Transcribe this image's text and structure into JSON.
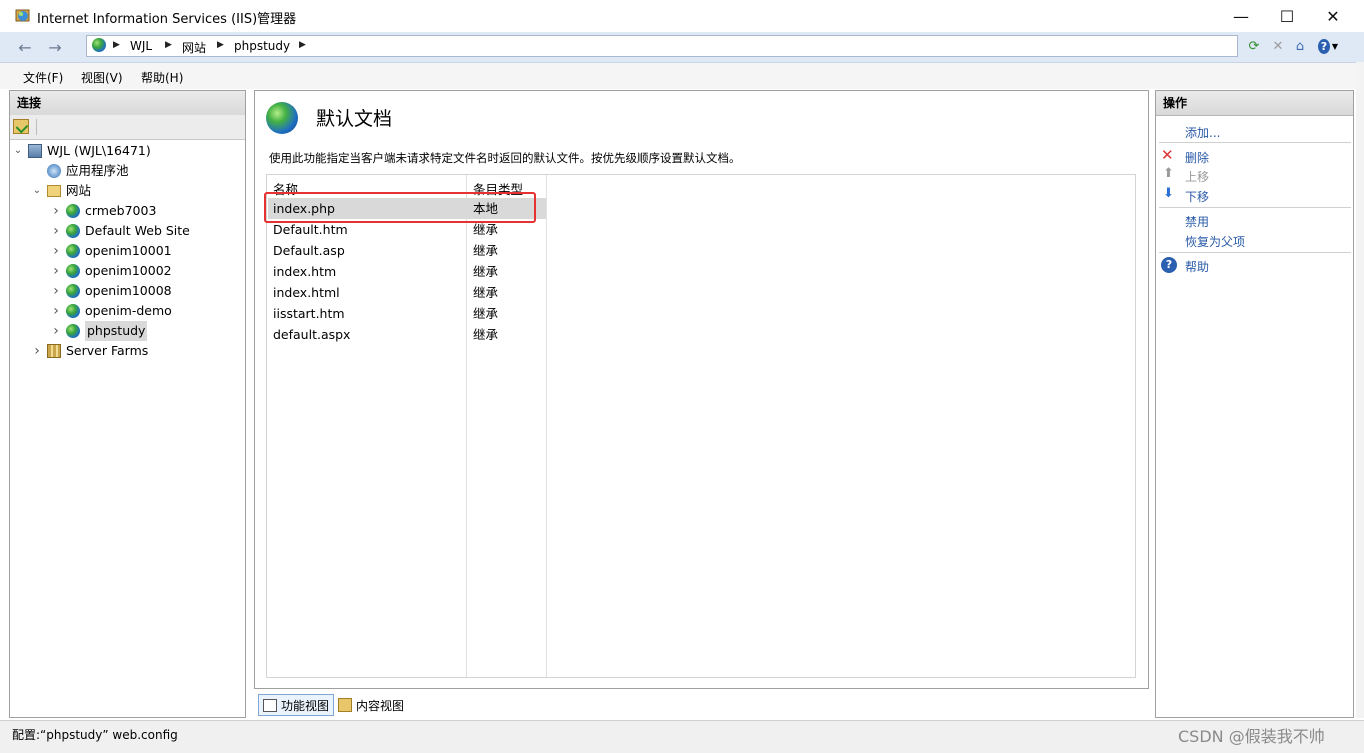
{
  "window": {
    "title": "Internet Information Services (IIS)管理器"
  },
  "breadcrumb": [
    "WJL",
    "网站",
    "phpstudy"
  ],
  "menu": [
    "文件(F)",
    "视图(V)",
    "帮助(H)"
  ],
  "connections": {
    "title": "连接",
    "tree": [
      {
        "label": "WJL (WJL\\16471)",
        "level": 0,
        "expanded": true,
        "icon": "server-icon"
      },
      {
        "label": "应用程序池",
        "level": 1,
        "expanded": null,
        "icon": "app-pool-icon"
      },
      {
        "label": "网站",
        "level": 1,
        "expanded": true,
        "icon": "folder-icon"
      },
      {
        "label": "crmeb7003",
        "level": 2,
        "expanded": false,
        "icon": "globe-icon"
      },
      {
        "label": "Default Web Site",
        "level": 2,
        "expanded": false,
        "icon": "globe-icon"
      },
      {
        "label": "openim10001",
        "level": 2,
        "expanded": false,
        "icon": "globe-icon"
      },
      {
        "label": "openim10002",
        "level": 2,
        "expanded": false,
        "icon": "globe-icon"
      },
      {
        "label": "openim10008",
        "level": 2,
        "expanded": false,
        "icon": "globe-icon"
      },
      {
        "label": "openim-demo",
        "level": 2,
        "expanded": false,
        "icon": "globe-icon"
      },
      {
        "label": "phpstudy",
        "level": 2,
        "expanded": false,
        "icon": "globe-icon",
        "selected": true
      },
      {
        "label": "Server Farms",
        "level": 1,
        "expanded": false,
        "icon": "server-farms-icon"
      }
    ]
  },
  "main": {
    "title": "默认文档",
    "description": "使用此功能指定当客户端未请求特定文件名时返回的默认文件。按优先级顺序设置默认文档。",
    "columns": [
      "名称",
      "条目类型"
    ],
    "rows": [
      {
        "name": "index.php",
        "type": "本地",
        "selected": true
      },
      {
        "name": "Default.htm",
        "type": "继承"
      },
      {
        "name": "Default.asp",
        "type": "继承"
      },
      {
        "name": "index.htm",
        "type": "继承"
      },
      {
        "name": "index.html",
        "type": "继承"
      },
      {
        "name": "iisstart.htm",
        "type": "继承"
      },
      {
        "name": "default.aspx",
        "type": "继承"
      }
    ],
    "tabs": [
      "功能视图",
      "内容视图"
    ]
  },
  "actions": {
    "title": "操作",
    "add": "添加...",
    "delete": "删除",
    "move_up": "上移",
    "move_down": "下移",
    "disable": "禁用",
    "revert": "恢复为父项",
    "help": "帮助"
  },
  "status": {
    "text": "配置:“phpstudy” web.config"
  },
  "watermark": "CSDN @假装我不帅",
  "colors": {
    "selection_outline": "#e53232",
    "link": "#2a5aa8",
    "address_bar": "#dfe8f5"
  }
}
